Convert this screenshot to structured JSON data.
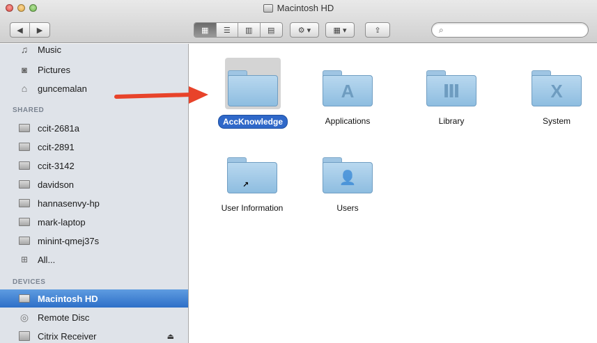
{
  "window": {
    "title": "Macintosh HD",
    "search_placeholder": ""
  },
  "toolbar": {
    "back": "◀",
    "forward": "▶",
    "view_icons": "▦",
    "view_list": "☰",
    "view_columns": "▥",
    "view_coverflow": "▤",
    "action": "⚙ ▾",
    "arrange": "▦ ▾",
    "share": "⇪",
    "search_glyph": "⌕"
  },
  "sidebar": {
    "favorites": [
      {
        "label": "Music",
        "icon": "music-icon"
      },
      {
        "label": "Pictures",
        "icon": "camera-icon"
      },
      {
        "label": "guncemalan",
        "icon": "home-icon"
      }
    ],
    "shared_header": "SHARED",
    "shared": [
      {
        "label": "ccit-2681a"
      },
      {
        "label": "ccit-2891"
      },
      {
        "label": "ccit-3142"
      },
      {
        "label": "davidson"
      },
      {
        "label": "hannasenvy-hp"
      },
      {
        "label": "mark-laptop"
      },
      {
        "label": "minint-qmej37s"
      },
      {
        "label": "All..."
      }
    ],
    "devices_header": "DEVICES",
    "devices": [
      {
        "label": "Macintosh HD",
        "selected": true
      },
      {
        "label": "Remote Disc"
      },
      {
        "label": "Citrix Receiver",
        "eject": "⏏"
      }
    ]
  },
  "main": {
    "items": [
      {
        "label": "AccKnowledge",
        "selected": true,
        "emblem": ""
      },
      {
        "label": "Applications",
        "emblem": "A"
      },
      {
        "label": "Library",
        "emblem": "Ⅲ"
      },
      {
        "label": "System",
        "emblem": "X"
      },
      {
        "label": "User Information",
        "emblem": "",
        "alias": "↗"
      },
      {
        "label": "Users",
        "emblem": "👤"
      }
    ]
  },
  "colors": {
    "selection_blue": "#2f68c9",
    "annotation_red": "#e8432a",
    "folder_blue": "#a9cdea"
  }
}
